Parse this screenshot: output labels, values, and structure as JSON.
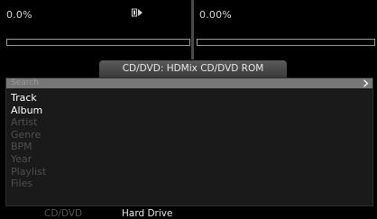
{
  "decks": {
    "left": {
      "percent": "0.0%",
      "progress": 0
    },
    "right": {
      "percent": "0.00%",
      "progress": 0
    }
  },
  "source": {
    "title": "CD/DVD: HDMix CD/DVD ROM"
  },
  "browser": {
    "search_placeholder": "Search",
    "categories": [
      {
        "label": "Track",
        "active": true
      },
      {
        "label": "Album",
        "active": true
      },
      {
        "label": "Artist",
        "active": false
      },
      {
        "label": "Genre",
        "active": false
      },
      {
        "label": "BPM",
        "active": false
      },
      {
        "label": "Year",
        "active": false
      },
      {
        "label": "Playlist",
        "active": false
      },
      {
        "label": "Files",
        "active": false
      }
    ]
  },
  "bottom_tabs": [
    {
      "label": "CD/DVD",
      "selected": false
    },
    {
      "label": "Hard Drive",
      "selected": true
    }
  ],
  "icons": {
    "play": "play-icon",
    "chevron": "chevron-right-icon"
  },
  "colors": {
    "active_text": "#ffffff",
    "inactive_text": "#4e4e4e",
    "search_bar": "#777777"
  }
}
